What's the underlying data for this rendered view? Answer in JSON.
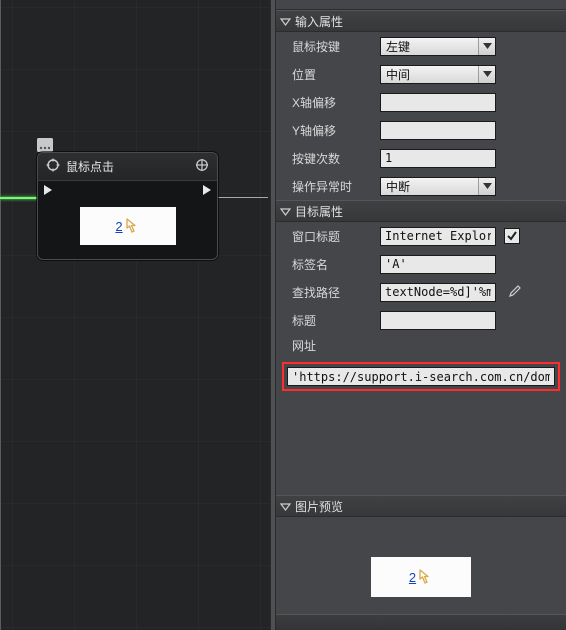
{
  "colors": {
    "highlight_border": "#ff2d2d",
    "wire_active": "#6fff6f"
  },
  "node": {
    "title": "鼠标点击",
    "preview_text": "2"
  },
  "sections": {
    "input": {
      "title": "输入属性",
      "rows": {
        "mouse_button": {
          "label": "鼠标按键",
          "value": "左键"
        },
        "position": {
          "label": "位置",
          "value": "中间"
        },
        "x_offset": {
          "label": "X轴偏移",
          "value": ""
        },
        "y_offset": {
          "label": "Y轴偏移",
          "value": ""
        },
        "press_count": {
          "label": "按键次数",
          "value": "1"
        },
        "on_exception": {
          "label": "操作异常时",
          "value": "中断"
        }
      }
    },
    "target": {
      "title": "目标属性",
      "rows": {
        "window_title": {
          "label": "窗口标题",
          "value": "Internet Explorer'",
          "checked": true
        },
        "tag_name": {
          "label": "标签名",
          "value": "'A'"
        },
        "find_path": {
          "label": "查找路径",
          "value": "textNode=%d]'%m"
        },
        "title": {
          "label": "标题",
          "value": ""
        },
        "url": {
          "label": "网址",
          "value": "'https://support.i-search.com.cn/domain/支持*'"
        }
      }
    },
    "preview": {
      "title": "图片预览",
      "text": "2"
    }
  }
}
